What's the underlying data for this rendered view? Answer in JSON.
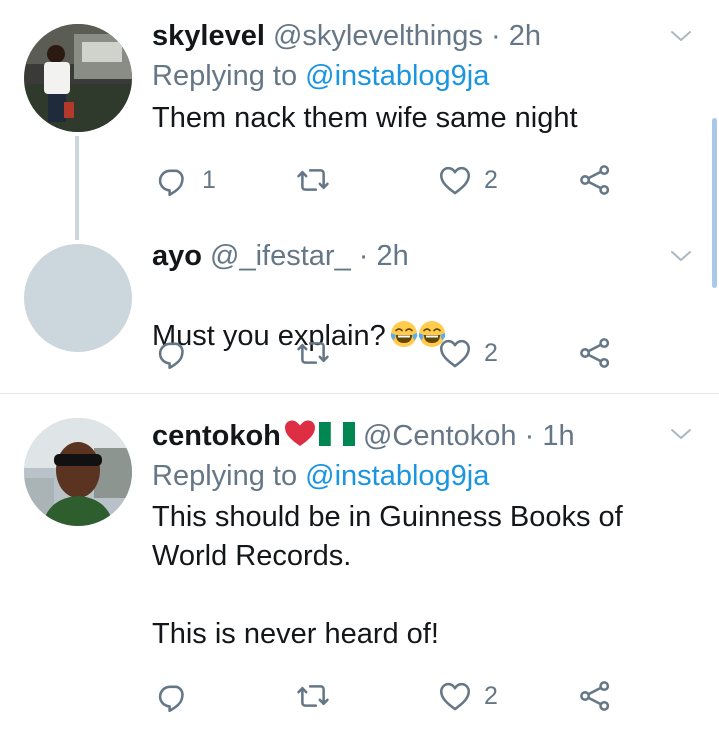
{
  "tweets": [
    {
      "name": "skylevel",
      "handle": "@skylevelthings",
      "dot": "·",
      "time": "2h",
      "replying_prefix": "Replying to",
      "replying_handle": "@instablog9ja",
      "text": "Them nack them wife same night",
      "reply_count": "1",
      "retweet_count": "",
      "like_count": "2"
    },
    {
      "name": "ayo",
      "handle": "@_ifestar_",
      "dot": "·",
      "time": "2h",
      "text": "Must you explain?",
      "reply_count": "",
      "retweet_count": "",
      "like_count": "2"
    },
    {
      "name": "centokoh",
      "handle": "@Centokoh",
      "dot": "·",
      "time": "1h",
      "replying_prefix": "Replying to",
      "replying_handle": "@instablog9ja",
      "text": "This should be in Guinness Books of\nWorld Records.\n\nThis is never heard of!",
      "reply_count": "",
      "retweet_count": "",
      "like_count": "2"
    }
  ],
  "icons": {
    "reply": "reply-icon",
    "retweet": "retweet-icon",
    "like": "heart-icon",
    "share": "share-icon",
    "caret": "chevron-down-icon",
    "emoji": "face-with-tears-of-joy",
    "heart_emoji": "red-heart",
    "flag_emoji": "nigeria-flag"
  },
  "colors": {
    "link": "#1b95e0",
    "secondary_text": "#657786",
    "primary_text": "#14171a",
    "thread_line": "#ccd6dd",
    "divider": "#e1e8ed"
  }
}
